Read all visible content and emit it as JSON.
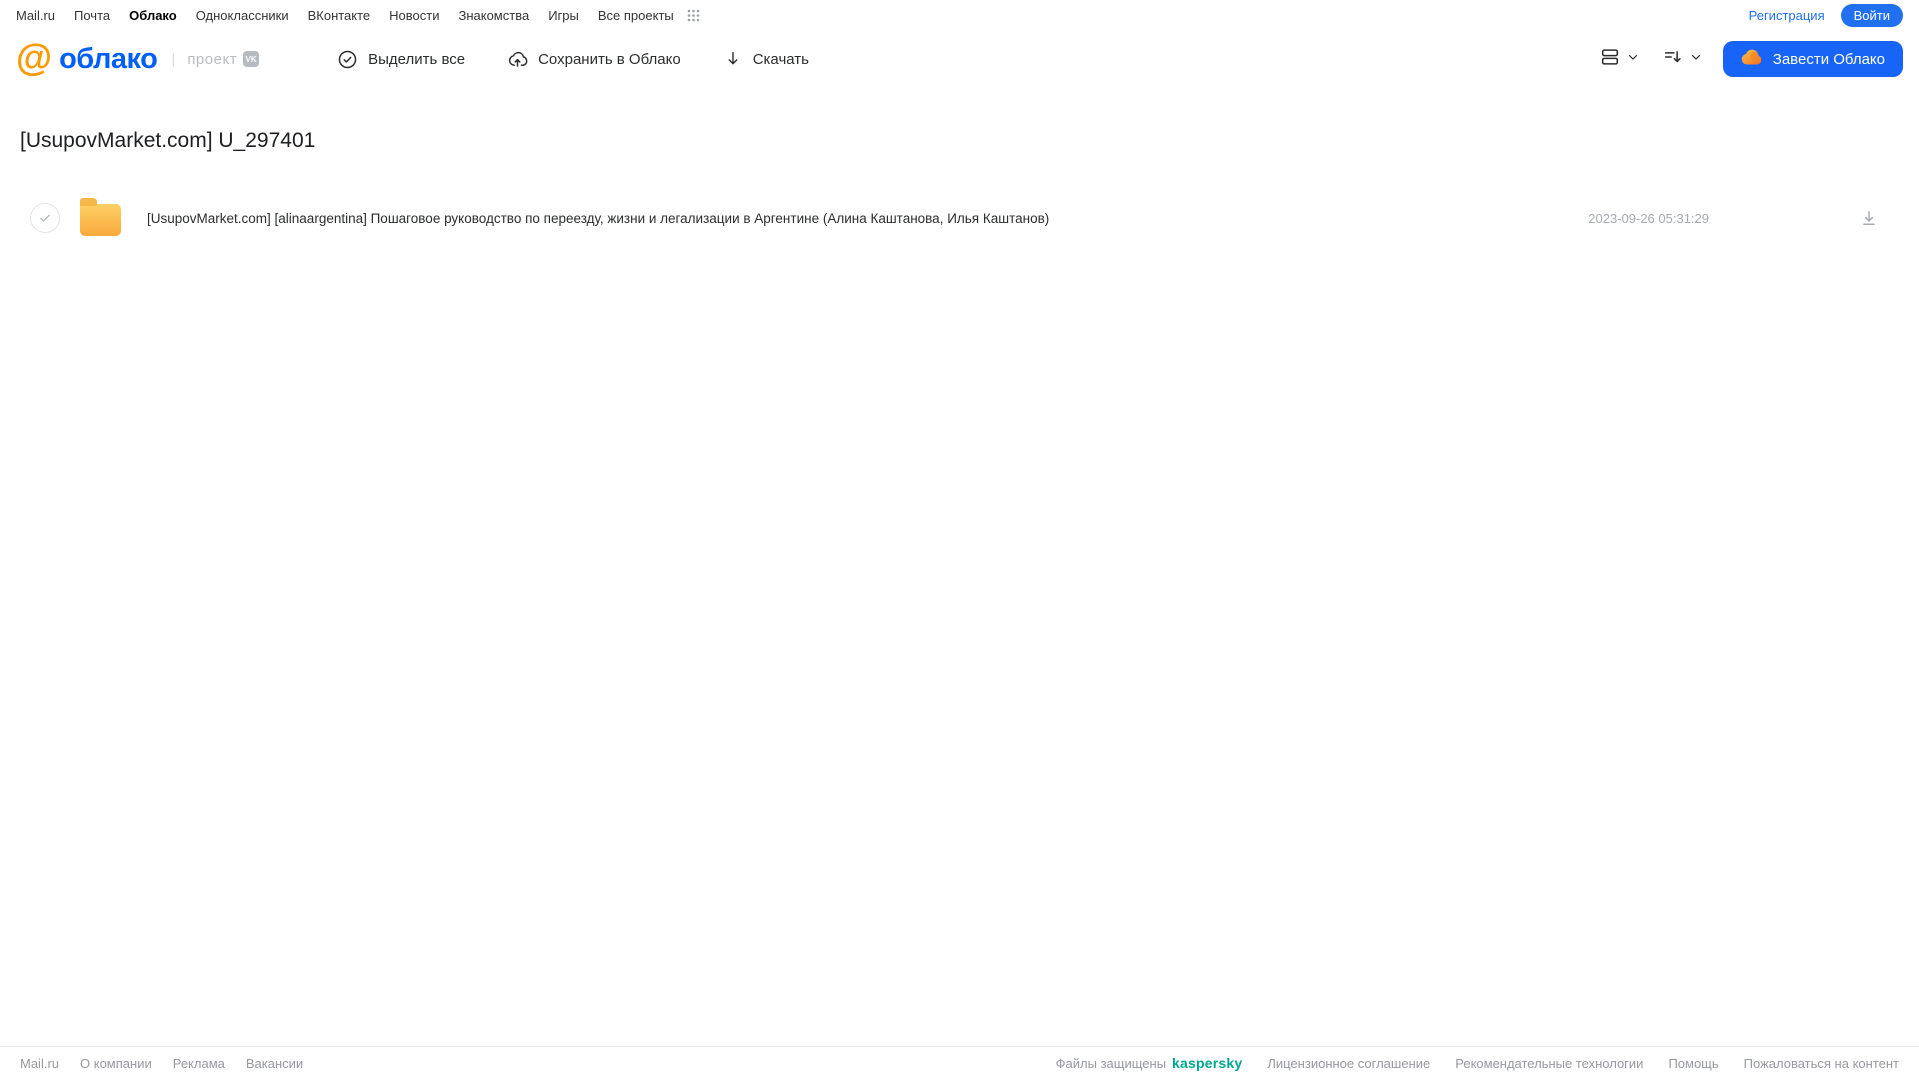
{
  "topbar": {
    "links": [
      {
        "label": "Mail.ru"
      },
      {
        "label": "Почта"
      },
      {
        "label": "Облако"
      },
      {
        "label": "Одноклассники"
      },
      {
        "label": "ВКонтакте"
      },
      {
        "label": "Новости"
      },
      {
        "label": "Знакомства"
      },
      {
        "label": "Игры"
      },
      {
        "label": "Все проекты"
      }
    ],
    "registration_label": "Регистрация",
    "login_label": "Войти"
  },
  "header": {
    "logo_at": "@",
    "logo_text": "облако",
    "logo_separator": "|",
    "project_label": "проект",
    "vk_badge": "VK",
    "toolbar": {
      "select_all_label": "Выделить все",
      "save_to_cloud_label": "Сохранить в Облако",
      "download_label": "Скачать"
    },
    "get_cloud_label": "Завести Облако"
  },
  "page": {
    "title": "[UsupovMarket.com] U_297401"
  },
  "files": [
    {
      "type": "folder",
      "name": "[UsupovMarket.com] [alinaargentina] Пошаговое руководство по переезду, жизни и легализации в Аргентине (Алина Каштанова, Илья Каштанов)",
      "date": "2023-09-26 05:31:29"
    }
  ],
  "footer": {
    "left_links": [
      "Mail.ru",
      "О компании",
      "Реклама",
      "Вакансии"
    ],
    "protected_label": "Файлы защищены",
    "kaspersky_label": "kaspersky",
    "right_links": [
      "Лицензионное соглашение",
      "Рекомендательные технологии",
      "Помощь",
      "Пожаловаться на контент"
    ]
  },
  "colors": {
    "accent_blue": "#1764f6",
    "link_blue": "#1f72f5",
    "logo_blue": "#005ff9",
    "logo_orange": "#ff9900",
    "kaspersky_green": "#00a88e",
    "folder_gradient_top": "#ffd065",
    "folder_gradient_bottom": "#f8a93c",
    "muted_gray": "#a7aaaf"
  }
}
